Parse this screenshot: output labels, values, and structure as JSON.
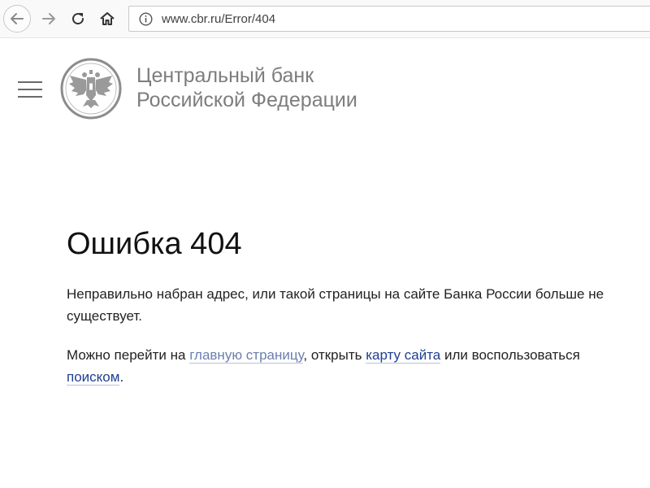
{
  "browser": {
    "url": "www.cbr.ru/Error/404",
    "buttons": {
      "back": "back-arrow-icon",
      "forward": "forward-arrow-icon",
      "reload": "reload-icon",
      "home": "home-icon"
    }
  },
  "header": {
    "title_line1": "Центральный банк",
    "title_line2": "Российской Федерации",
    "menu_icon": "hamburger-menu-icon",
    "logo": "bank-of-russia-emblem"
  },
  "content": {
    "heading": "Ошибка 404",
    "paragraph1_line1": "Неправильно набран адрес, или такой страницы на сайте Банка России больше не",
    "paragraph1_line2": "существует.",
    "paragraph2_prefix": "Можно перейти на ",
    "link_home": "главную страницу",
    "paragraph2_middle": ", открыть ",
    "link_sitemap": "карту сайта",
    "paragraph2_suffix": " или воспользоваться",
    "link_search": "поиском",
    "paragraph2_end": "."
  },
  "colors": {
    "header_text": "#7d7d7d",
    "link": "#1f3f8f",
    "link_visited": "#6b7fb0"
  }
}
